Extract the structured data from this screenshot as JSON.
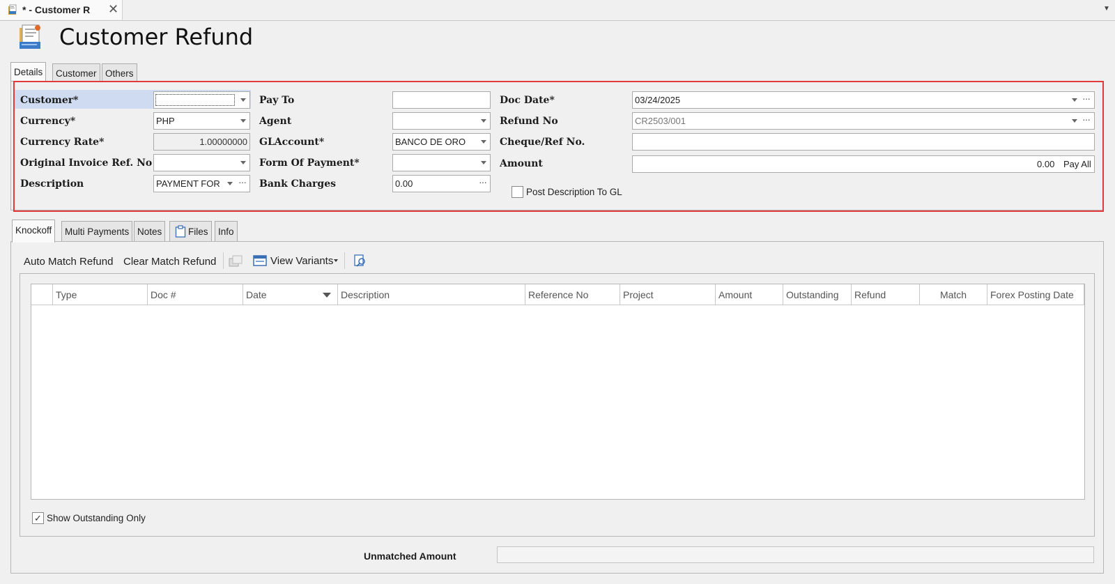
{
  "doc_tab": {
    "title": "* - Customer R",
    "close": "✕"
  },
  "header": {
    "title": "Customer Refund"
  },
  "top_tabs": [
    "Details",
    "Customer",
    "Others"
  ],
  "form": {
    "customer_label": "Customer*",
    "customer_value": "",
    "currency_label": "Currency*",
    "currency_value": "PHP",
    "currency_rate_label": "Currency Rate*",
    "currency_rate_value": "1.00000000",
    "orig_invoice_label": "Original Invoice Ref. No",
    "orig_invoice_value": "",
    "description_label": "Description",
    "description_value": "PAYMENT FOR",
    "pay_to_label": "Pay To",
    "pay_to_value": "",
    "agent_label": "Agent",
    "agent_value": "",
    "glaccount_label": "GLAccount*",
    "glaccount_value": "BANCO DE ORO",
    "form_of_payment_label": "Form Of Payment*",
    "form_of_payment_value": "",
    "bank_charges_label": "Bank Charges",
    "bank_charges_value": "0.00",
    "doc_date_label": "Doc Date*",
    "doc_date_value": "03/24/2025",
    "refund_no_label": "Refund No",
    "refund_no_value": "CR2503/001",
    "cheque_label": "Cheque/Ref No.",
    "cheque_value": "",
    "amount_label": "Amount",
    "amount_value": "0.00",
    "pay_all_label": "Pay All",
    "post_desc_label": "Post Description To GL",
    "post_desc_checked": false
  },
  "bottom_tabs": [
    "Knockoff",
    "Multi Payments",
    "Notes",
    "Files",
    "Info"
  ],
  "toolbar": {
    "auto_match": "Auto Match Refund",
    "clear_match": "Clear Match Refund",
    "view_variants": "View Variants"
  },
  "grid": {
    "columns": [
      "Type",
      "Doc #",
      "Date",
      "Description",
      "Reference No",
      "Project",
      "Amount",
      "Outstanding",
      "Refund",
      "Match",
      "Forex Posting Date"
    ]
  },
  "show_outstanding_label": "Show Outstanding Only",
  "show_outstanding_checked": true,
  "unmatched_amount_label": "Unmatched Amount",
  "unmatched_amount_value": ""
}
